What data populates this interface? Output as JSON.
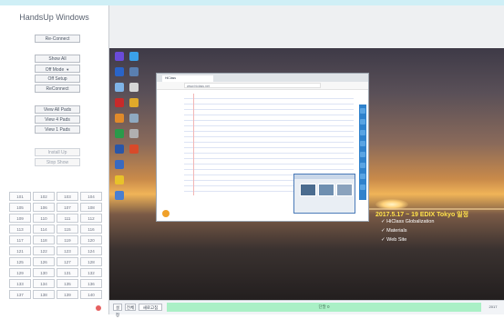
{
  "colors": {
    "top_strip": "#cfeff6",
    "status_bar": "#aaf0c6",
    "overlay_title": "#ffe14a",
    "toolbar_blue": "#2f82cc"
  },
  "app": {
    "title": "HandsUp Windows"
  },
  "left_panel": {
    "buttons": [
      {
        "label": "Re-Connect",
        "enabled": true
      },
      {
        "label": "Show All",
        "enabled": true
      },
      {
        "label": "Off Mode",
        "enabled": true,
        "dropdown": true
      },
      {
        "label": "Off Setup",
        "enabled": true
      },
      {
        "label": "ReConnect",
        "enabled": true
      },
      {
        "label": "View All Pads",
        "enabled": true
      },
      {
        "label": "View 4 Pads",
        "enabled": true
      },
      {
        "label": "View 1 Pads",
        "enabled": true
      },
      {
        "label": "Install Up",
        "enabled": false
      },
      {
        "label": "Stop Show",
        "enabled": false
      }
    ],
    "grid_cells": [
      "101",
      "102",
      "103",
      "104",
      "105",
      "106",
      "107",
      "108",
      "109",
      "110",
      "111",
      "112",
      "113",
      "114",
      "115",
      "116",
      "117",
      "118",
      "119",
      "120",
      "121",
      "122",
      "123",
      "124",
      "125",
      "126",
      "127",
      "128",
      "129",
      "130",
      "131",
      "132",
      "133",
      "134",
      "135",
      "136",
      "137",
      "138",
      "139",
      "140"
    ]
  },
  "desktop": {
    "icons": [
      {
        "name": "app-icon",
        "color": "#6a4bd8"
      },
      {
        "name": "app-icon",
        "color": "#3aa0e8"
      },
      {
        "name": "browser-icon",
        "color": "#2a64c8"
      },
      {
        "name": "app-icon",
        "color": "#5a7fb0"
      },
      {
        "name": "app-icon",
        "color": "#7fb3e6"
      },
      {
        "name": "app-icon",
        "color": "#d6d6d6"
      },
      {
        "name": "app-icon",
        "color": "#c82a2a"
      },
      {
        "name": "app-icon",
        "color": "#e0a92a"
      },
      {
        "name": "app-icon",
        "color": "#e08a2a"
      },
      {
        "name": "app-icon",
        "color": "#8fa9c0"
      },
      {
        "name": "app-icon",
        "color": "#2a9a4a"
      },
      {
        "name": "app-icon",
        "color": "#b0b0b0"
      },
      {
        "name": "app-icon",
        "color": "#2a56a8"
      },
      {
        "name": "app-icon",
        "color": "#d84a2a"
      },
      {
        "name": "app-icon",
        "color": "#3a6ac0"
      },
      {
        "name": "app-icon",
        "color": "#e8c22a"
      },
      {
        "name": "app-icon",
        "color": "#4a7fd0"
      }
    ],
    "overlay": {
      "title": "2017.5.17 ~ 19 EDIX Tokyo 일정",
      "items": [
        "✓ HiClass Globalization",
        "✓ Materials",
        "✓ Web Site"
      ]
    },
    "browser": {
      "tab_title": "HiClass",
      "address": "www.hiclass.net"
    }
  },
  "bottom_bar": {
    "buttons": [
      "설정",
      "전체",
      "새로고침"
    ],
    "status": "단말 0",
    "counter": "2017"
  }
}
